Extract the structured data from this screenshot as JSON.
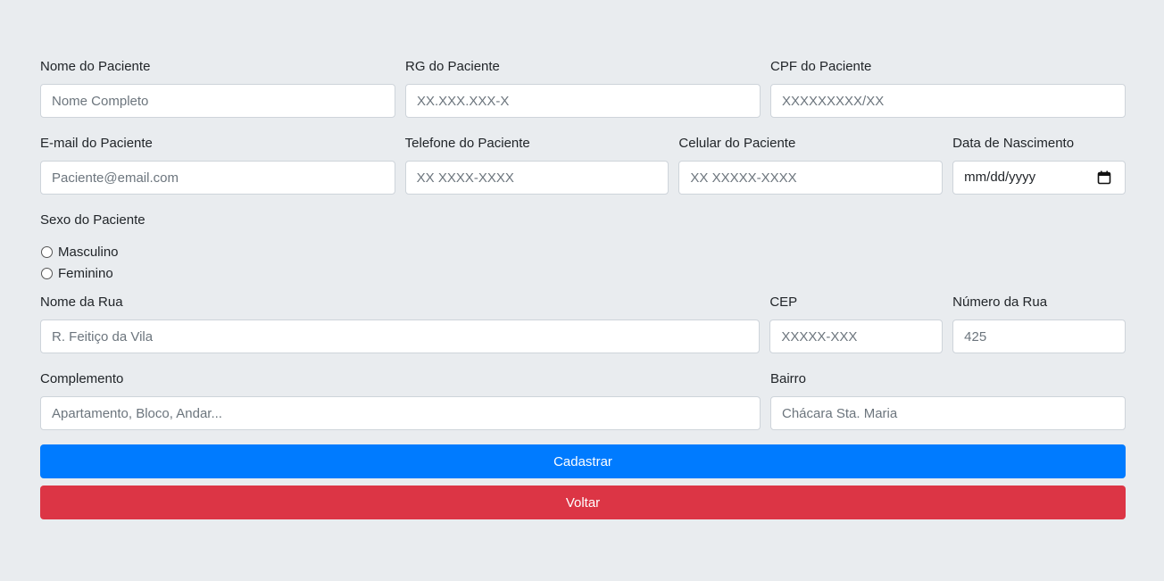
{
  "form": {
    "nome": {
      "label": "Nome do Paciente",
      "placeholder": "Nome Completo"
    },
    "rg": {
      "label": "RG do Paciente",
      "placeholder": "XX.XXX.XXX-X"
    },
    "cpf": {
      "label": "CPF do Paciente",
      "placeholder": "XXXXXXXXX/XX"
    },
    "email": {
      "label": "E-mail do Paciente",
      "placeholder": "Paciente@email.com"
    },
    "telefone": {
      "label": "Telefone do Paciente",
      "placeholder": "XX XXXX-XXXX"
    },
    "celular": {
      "label": "Celular do Paciente",
      "placeholder": "XX XXXXX-XXXX"
    },
    "nascimento": {
      "label": "Data de Nascimento",
      "value": "mm/dd/yyyy"
    },
    "sexo": {
      "label": "Sexo do Paciente",
      "options": [
        "Masculino",
        "Feminino"
      ]
    },
    "rua": {
      "label": "Nome da Rua",
      "placeholder": "R. Feitiço da Vila"
    },
    "cep": {
      "label": "CEP",
      "placeholder": "XXXXX-XXX"
    },
    "numero": {
      "label": "Número da Rua",
      "placeholder": "425"
    },
    "complemento": {
      "label": "Complemento",
      "placeholder": "Apartamento, Bloco, Andar..."
    },
    "bairro": {
      "label": "Bairro",
      "placeholder": "Chácara Sta. Maria"
    }
  },
  "buttons": {
    "cadastrar": "Cadastrar",
    "voltar": "Voltar"
  },
  "colors": {
    "background": "#e9ecef",
    "primary": "#007bff",
    "danger": "#dc3545"
  }
}
